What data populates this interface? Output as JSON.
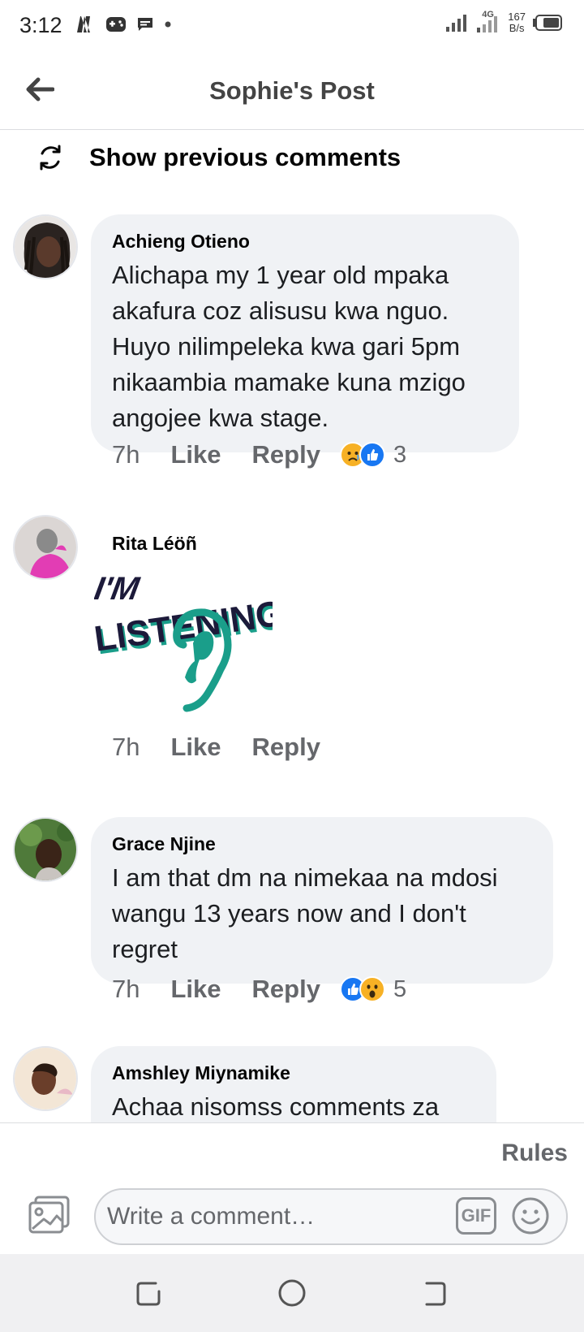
{
  "status_bar": {
    "time": "3:12",
    "network": "4G",
    "speed_value": "167",
    "speed_unit": "B/s"
  },
  "header": {
    "title": "Sophie's Post"
  },
  "previous_comments": {
    "label": "Show previous comments"
  },
  "comments": [
    {
      "author": "Achieng Otieno",
      "text": "Alichapa my 1 year old mpaka akafura coz alisusu kwa nguo. Huyo nilimpeleka kwa gari 5pm nikaambia mamake kuna mzigo angojee kwa stage.",
      "time": "7h",
      "like": "Like",
      "reply": "Reply",
      "reactions": [
        "sad",
        "like"
      ],
      "reaction_count": "3"
    },
    {
      "author": "Rita Léöñ",
      "sticker": {
        "line1": "I'M",
        "line2": "LISTENING"
      },
      "time": "7h",
      "like": "Like",
      "reply": "Reply"
    },
    {
      "author": "Grace Njine",
      "text": "I am that dm na nimekaa na mdosi wangu 13 years now and I don't regret",
      "time": "7h",
      "like": "Like",
      "reply": "Reply",
      "reactions": [
        "like",
        "wow"
      ],
      "reaction_count": "5"
    },
    {
      "author": "Amshley Miynamike",
      "text": "Achaa nisomss comments za"
    }
  ],
  "composer": {
    "rules_label": "Rules",
    "placeholder": "Write a comment…",
    "gif_label": "GIF"
  },
  "colors": {
    "like_blue": "#1877f2",
    "sad_yellow": "#f7b125",
    "bubble_bg": "#f0f2f5",
    "sticker_teal": "#1a9e8a",
    "sticker_navy": "#1c1a3a"
  }
}
